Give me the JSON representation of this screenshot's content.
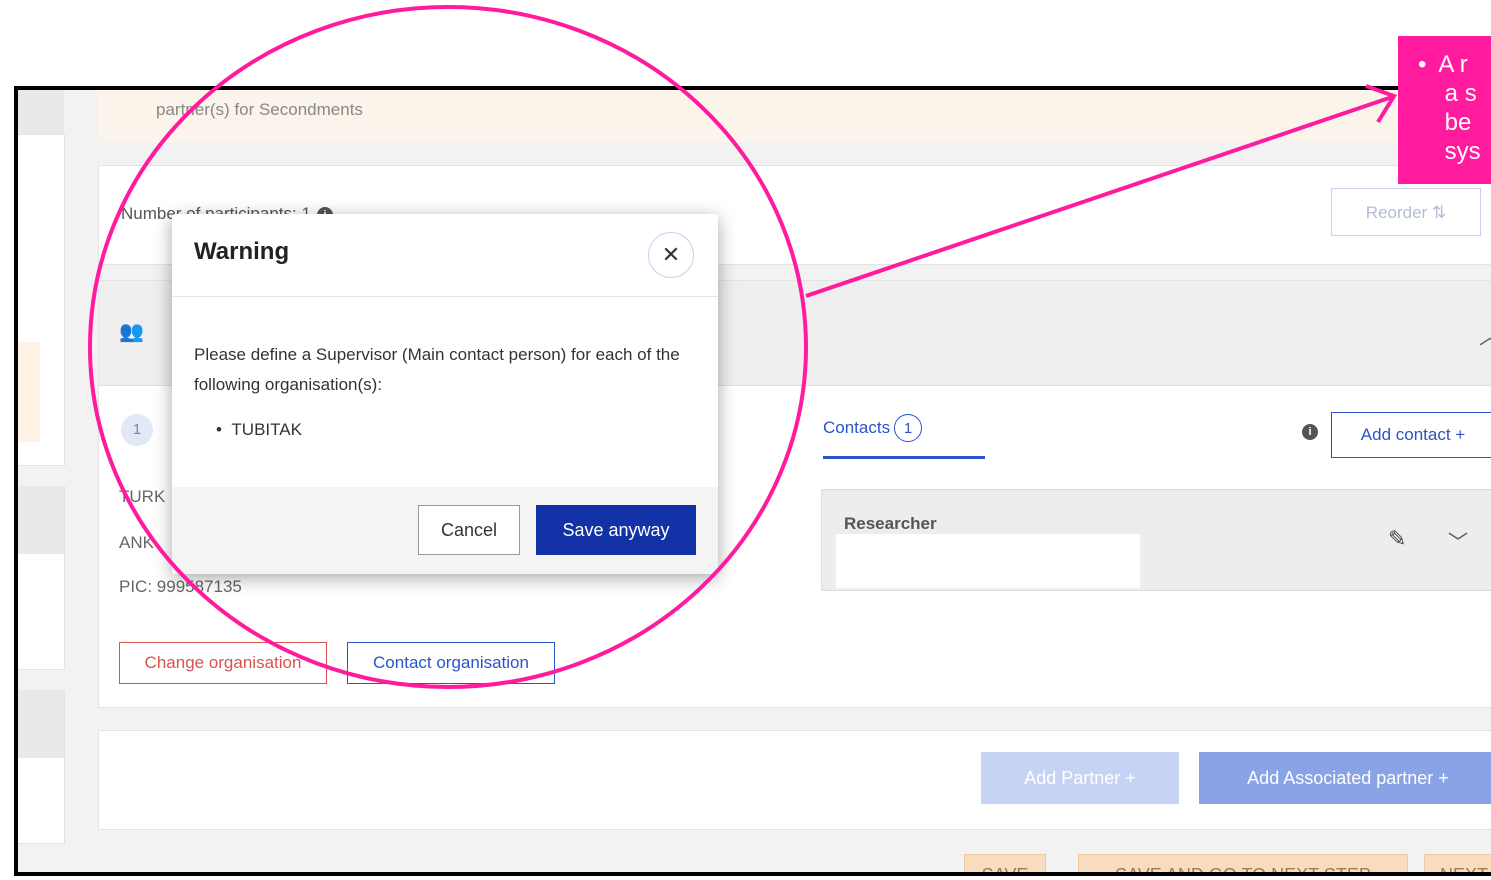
{
  "page": {
    "banner_text": "partner(s) for Secondments",
    "participants_label": "Number of participants: 1",
    "reorder_label": "Reorder ⇅"
  },
  "partner": {
    "number": "1",
    "org_line_1": "TURK",
    "org_line_2": "ANK",
    "pic": "PIC: 999587135",
    "change_org_label": "Change organisation",
    "contact_org_label": "Contact organisation"
  },
  "contacts": {
    "tab_label": "Contacts",
    "count": "1",
    "add_contact_label": "Add contact  +",
    "researcher_label": "Researcher"
  },
  "actions": {
    "add_partner_label": "Add Partner   +",
    "add_associated_label": "Add Associated partner   +",
    "save_label": "SAVE",
    "save_next_label": "SAVE AND GO TO NEXT STEP",
    "next_label": "NEXT"
  },
  "modal": {
    "title": "Warning",
    "close_symbol": "✕",
    "message": "Please define a Supervisor (Main contact person) for each of the following organisation(s):",
    "items": [
      "TUBITAK"
    ],
    "cancel_label": "Cancel",
    "save_anyway_label": "Save anyway"
  },
  "annotation": {
    "callout_text": "•  A r\n    a s\n    be\n    sys",
    "color": "#ff1a9e"
  }
}
